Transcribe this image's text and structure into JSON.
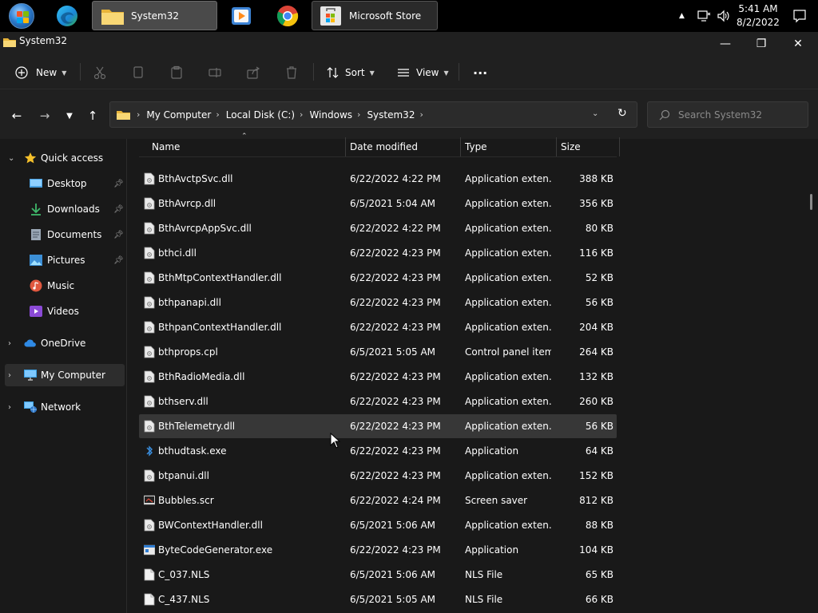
{
  "taskbar": {
    "apps": [
      {
        "label": "System32",
        "active": true
      },
      {
        "label": "Microsoft Store",
        "active": false
      }
    ],
    "clock": {
      "time": "5:41 AM",
      "date": "8/2/2022"
    }
  },
  "window": {
    "title": "System32",
    "minimize": "—",
    "maximize": "❐",
    "close": "✕"
  },
  "toolbar": {
    "new_label": "New",
    "sort_label": "Sort",
    "view_label": "View",
    "more_label": "···"
  },
  "address": {
    "crumbs": [
      "My Computer",
      "Local Disk (C:)",
      "Windows",
      "System32"
    ],
    "search_placeholder": "Search System32"
  },
  "sidebar": {
    "quick_access": "Quick access",
    "items": [
      {
        "label": "Desktop"
      },
      {
        "label": "Downloads"
      },
      {
        "label": "Documents"
      },
      {
        "label": "Pictures"
      },
      {
        "label": "Music"
      },
      {
        "label": "Videos"
      }
    ],
    "onedrive": "OneDrive",
    "mycomputer": "My Computer",
    "network": "Network"
  },
  "columns": {
    "name": "Name",
    "date": "Date modified",
    "type": "Type",
    "size": "Size"
  },
  "files": [
    {
      "name": "BthAvctpSvc.dll",
      "date": "6/22/2022 4:22 PM",
      "type": "Application exten...",
      "size": "388 KB",
      "icon": "dll"
    },
    {
      "name": "BthAvrcp.dll",
      "date": "6/5/2021 5:04 AM",
      "type": "Application exten...",
      "size": "356 KB",
      "icon": "dll"
    },
    {
      "name": "BthAvrcpAppSvc.dll",
      "date": "6/22/2022 4:22 PM",
      "type": "Application exten...",
      "size": "80 KB",
      "icon": "dll"
    },
    {
      "name": "bthci.dll",
      "date": "6/22/2022 4:23 PM",
      "type": "Application exten...",
      "size": "116 KB",
      "icon": "dll"
    },
    {
      "name": "BthMtpContextHandler.dll",
      "date": "6/22/2022 4:23 PM",
      "type": "Application exten...",
      "size": "52 KB",
      "icon": "dll"
    },
    {
      "name": "bthpanapi.dll",
      "date": "6/22/2022 4:23 PM",
      "type": "Application exten...",
      "size": "56 KB",
      "icon": "dll"
    },
    {
      "name": "BthpanContextHandler.dll",
      "date": "6/22/2022 4:23 PM",
      "type": "Application exten...",
      "size": "204 KB",
      "icon": "dll"
    },
    {
      "name": "bthprops.cpl",
      "date": "6/5/2021 5:05 AM",
      "type": "Control panel item",
      "size": "264 KB",
      "icon": "dll"
    },
    {
      "name": "BthRadioMedia.dll",
      "date": "6/22/2022 4:23 PM",
      "type": "Application exten...",
      "size": "132 KB",
      "icon": "dll"
    },
    {
      "name": "bthserv.dll",
      "date": "6/22/2022 4:23 PM",
      "type": "Application exten...",
      "size": "260 KB",
      "icon": "dll"
    },
    {
      "name": "BthTelemetry.dll",
      "date": "6/22/2022 4:23 PM",
      "type": "Application exten...",
      "size": "56 KB",
      "icon": "dll",
      "highlight": true
    },
    {
      "name": "bthudtask.exe",
      "date": "6/22/2022 4:23 PM",
      "type": "Application",
      "size": "64 KB",
      "icon": "bt"
    },
    {
      "name": "btpanui.dll",
      "date": "6/22/2022 4:23 PM",
      "type": "Application exten...",
      "size": "152 KB",
      "icon": "dll"
    },
    {
      "name": "Bubbles.scr",
      "date": "6/22/2022 4:24 PM",
      "type": "Screen saver",
      "size": "812 KB",
      "icon": "scr"
    },
    {
      "name": "BWContextHandler.dll",
      "date": "6/5/2021 5:06 AM",
      "type": "Application exten...",
      "size": "88 KB",
      "icon": "dll"
    },
    {
      "name": "ByteCodeGenerator.exe",
      "date": "6/22/2022 4:23 PM",
      "type": "Application",
      "size": "104 KB",
      "icon": "exe"
    },
    {
      "name": "C_037.NLS",
      "date": "6/5/2021 5:06 AM",
      "type": "NLS File",
      "size": "65 KB",
      "icon": "file"
    },
    {
      "name": "C_437.NLS",
      "date": "6/5/2021 5:05 AM",
      "type": "NLS File",
      "size": "66 KB",
      "icon": "file"
    }
  ]
}
